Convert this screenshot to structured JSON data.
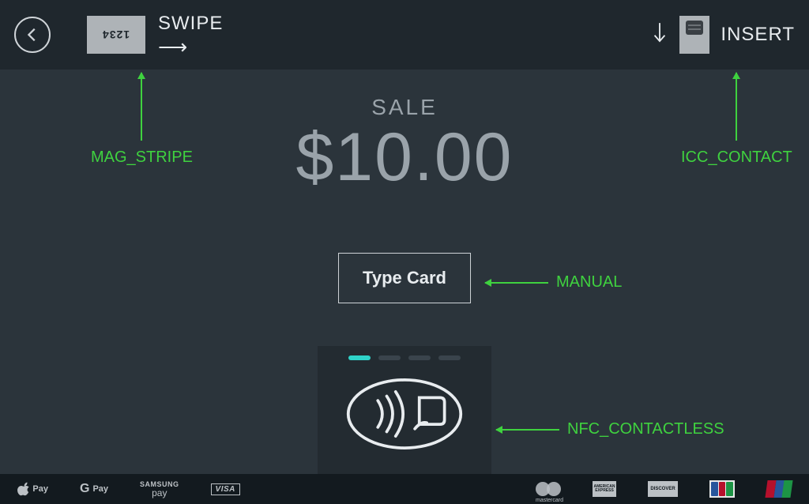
{
  "topbar": {
    "swipe": {
      "card_digits": "1234",
      "label": "SWIPE"
    },
    "insert": {
      "label": "INSERT"
    }
  },
  "sale": {
    "label": "SALE",
    "amount": "$10.00"
  },
  "type_card": {
    "label": "Type Card"
  },
  "annotations": {
    "mag_stripe": "MAG_STRIPE",
    "icc_contact": "ICC_CONTACT",
    "manual": "MANUAL",
    "nfc_contactless": "NFC_CONTACTLESS"
  },
  "footer": {
    "apple_pay": "Pay",
    "google_pay": "Pay",
    "samsung_pay_top": "SAMSUNG",
    "samsung_pay_bottom": "pay",
    "visa": "VISA",
    "mastercard": "mastercard",
    "amex": "AMERICAN\nEXPRESS",
    "discover": "DISCOVER",
    "jcb": "JCB",
    "unionpay": "UnionPay"
  }
}
